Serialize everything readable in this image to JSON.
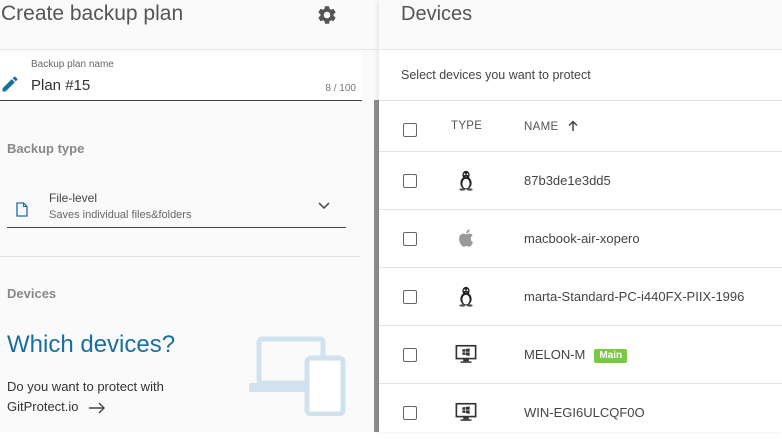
{
  "left": {
    "title": "Create backup plan",
    "plan_name": {
      "label": "Backup plan name",
      "value": "Plan #15",
      "counter": "8 / 100"
    },
    "backup_type": {
      "section_title": "Backup type",
      "selected_title": "File-level",
      "selected_subtitle": "Saves individual files&folders"
    },
    "devices": {
      "section_title": "Devices",
      "promo_title": "Which devices?",
      "promo_text": "Do you want to protect with GitProtect.io"
    }
  },
  "right": {
    "title": "Devices",
    "subtitle": "Select devices you want to protect",
    "columns": {
      "type": "TYPE",
      "name": "NAME"
    },
    "rows": [
      {
        "type_icon": "linux-icon",
        "name": "87b3de1e3dd5",
        "badge": ""
      },
      {
        "type_icon": "apple-icon",
        "name": "macbook-air-xopero",
        "badge": ""
      },
      {
        "type_icon": "linux-icon",
        "name": "marta-Standard-PC-i440FX-PIIX-1996",
        "badge": ""
      },
      {
        "type_icon": "windows-desktop-icon",
        "name": "MELON-M",
        "badge": "Main"
      },
      {
        "type_icon": "windows-desktop-icon",
        "name": "WIN-EGI6ULCQF0O",
        "badge": ""
      }
    ]
  },
  "colors": {
    "accent": "#1a6fa0",
    "badge": "#7ac943",
    "illustration": "#cfe2ee"
  }
}
